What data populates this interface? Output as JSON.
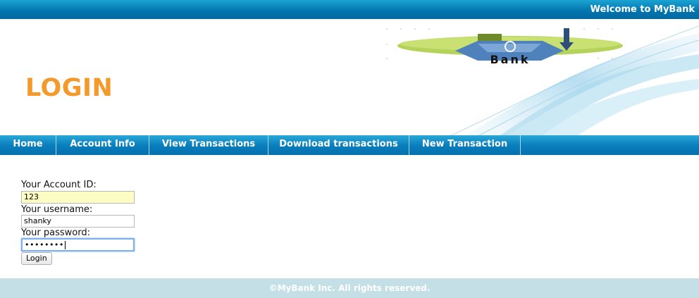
{
  "topbar": {
    "welcome": "Welcome to MyBank"
  },
  "header": {
    "title": "LOGIN",
    "logo_text": "Bank"
  },
  "nav": {
    "items": [
      {
        "label": "Home"
      },
      {
        "label": "Account Info"
      },
      {
        "label": "View Transactions"
      },
      {
        "label": "Download transactions"
      },
      {
        "label": "New Transaction"
      }
    ]
  },
  "form": {
    "account_id_label": "Your Account ID:",
    "account_id_value": "123",
    "username_label": "Your username:",
    "username_value": "shanky",
    "password_label": "Your password:",
    "password_value": "••••••••",
    "login_button": "Login"
  },
  "footer": {
    "text": "©MyBank Inc. All rights reserved."
  },
  "colors": {
    "topbar": "#0273ad",
    "navbar": "#0a7fbd",
    "title": "#f39a2b",
    "footer": "#c5dfe6",
    "autofill": "#fbfdc5",
    "focus": "#7fb0ee"
  }
}
